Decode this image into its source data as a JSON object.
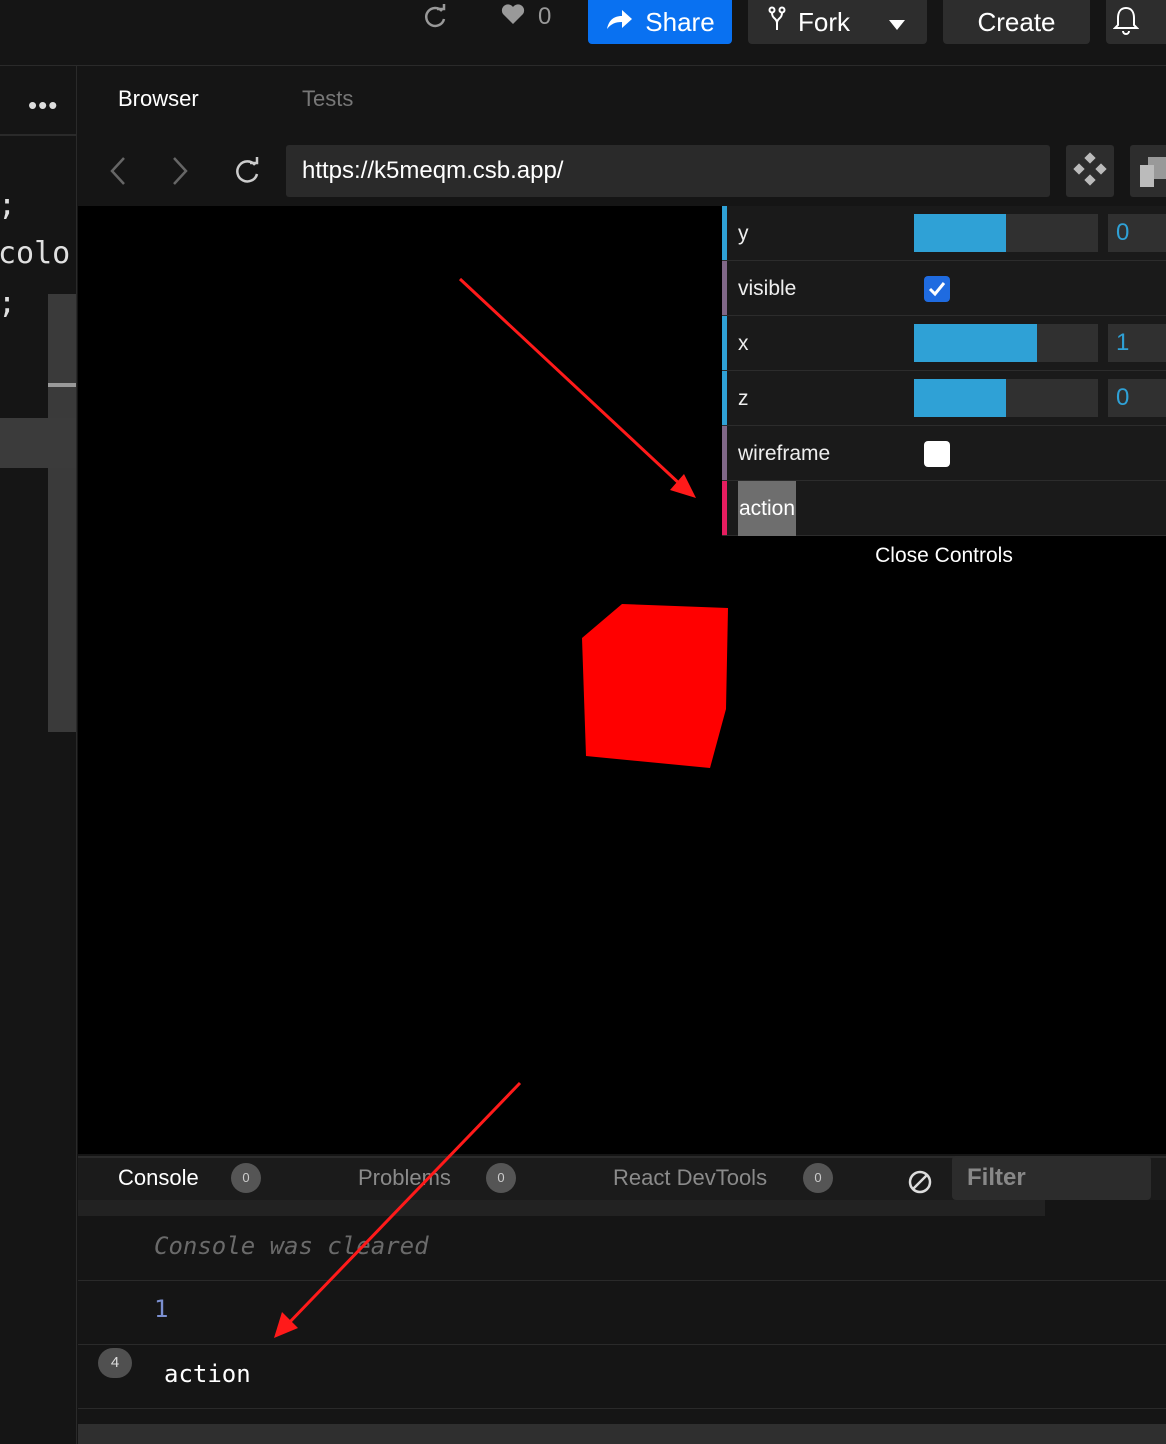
{
  "topbar": {
    "likes_count": "0",
    "share_label": "Share",
    "fork_label": "Fork",
    "create_label": "Create"
  },
  "editor": {
    "code_lines": [
      ";",
      "colo:",
      ";"
    ]
  },
  "browser": {
    "tabs": [
      {
        "label": "Browser",
        "active": true
      },
      {
        "label": "Tests",
        "active": false
      }
    ],
    "url": "https://k5meqm.csb.app/"
  },
  "controls": {
    "rows": [
      {
        "label": "y",
        "type": "slider",
        "value": "0",
        "fill": 0.5,
        "accent": "#2fa1d6"
      },
      {
        "label": "visible",
        "type": "checkbox",
        "checked": true,
        "accent": "#806787"
      },
      {
        "label": "x",
        "type": "slider",
        "value": "1",
        "fill": 0.67,
        "accent": "#2fa1d6"
      },
      {
        "label": "z",
        "type": "slider",
        "value": "0",
        "fill": 0.5,
        "accent": "#2fa1d6"
      },
      {
        "label": "wireframe",
        "type": "checkbox",
        "checked": false,
        "accent": "#806787"
      },
      {
        "label": "action",
        "type": "function",
        "accent": "#e61d5f"
      }
    ],
    "close_label": "Close Controls"
  },
  "scene": {
    "cube_color": "#ff0000",
    "background": "#000000"
  },
  "console": {
    "tabs": [
      {
        "label": "Console",
        "count": "0"
      },
      {
        "label": "Problems",
        "count": "0"
      },
      {
        "label": "React DevTools",
        "count": "0"
      }
    ],
    "filter_placeholder": "Filter",
    "lines": [
      {
        "text": "Console was cleared",
        "kind": "info"
      },
      {
        "text": "1",
        "kind": "number"
      },
      {
        "text": "action",
        "kind": "log",
        "repeat": "4"
      }
    ]
  },
  "annotations": {
    "arrow_color": "#ff1a1a"
  }
}
